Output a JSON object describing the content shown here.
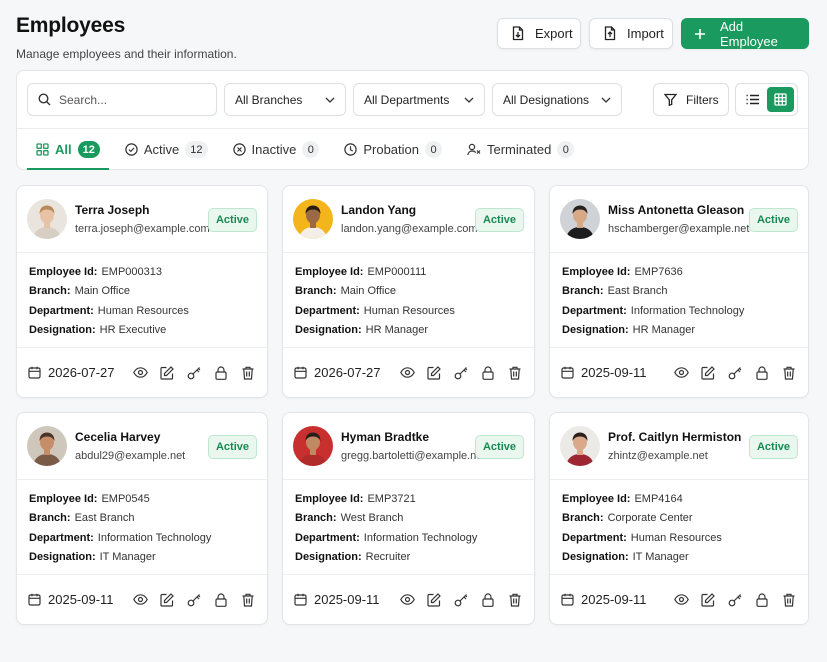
{
  "header": {
    "title": "Employees",
    "subtitle": "Manage employees and their information."
  },
  "actions": {
    "export_label": "Export",
    "import_label": "Import",
    "add_label": "Add Employee"
  },
  "filters": {
    "search_placeholder": "Search...",
    "branch": "All Branches",
    "department": "All Departments",
    "designation": "All Designations",
    "filters_label": "Filters"
  },
  "tabs": [
    {
      "label": "All",
      "count": "12"
    },
    {
      "label": "Active",
      "count": "12"
    },
    {
      "label": "Inactive",
      "count": "0"
    },
    {
      "label": "Probation",
      "count": "0"
    },
    {
      "label": "Terminated",
      "count": "0"
    }
  ],
  "labels": {
    "employee_id": "Employee Id:",
    "branch": "Branch:",
    "department": "Department:",
    "designation": "Designation:"
  },
  "colors": {
    "accent": "#1a9a5e",
    "badge_bg": "#e9f7ef",
    "badge_text": "#178a52"
  },
  "employees": [
    {
      "name": "Terra Joseph",
      "email": "terra.joseph@example.com",
      "status": "Active",
      "employee_id": "EMP000313",
      "branch": "Main Office",
      "department": "Human Resources",
      "designation": "HR Executive",
      "date": "2026-07-27"
    },
    {
      "name": "Landon Yang",
      "email": "landon.yang@example.com",
      "status": "Active",
      "employee_id": "EMP000111",
      "branch": "Main Office",
      "department": "Human Resources",
      "designation": "HR Manager",
      "date": "2026-07-27"
    },
    {
      "name": "Miss Antonetta Gleason",
      "email": "hschamberger@example.net",
      "status": "Active",
      "employee_id": "EMP7636",
      "branch": "East Branch",
      "department": "Information Technology",
      "designation": "HR Manager",
      "date": "2025-09-11"
    },
    {
      "name": "Cecelia Harvey",
      "email": "abdul29@example.net",
      "status": "Active",
      "employee_id": "EMP0545",
      "branch": "East Branch",
      "department": "Information Technology",
      "designation": "IT Manager",
      "date": "2025-09-11"
    },
    {
      "name": "Hyman Bradtke",
      "email": "gregg.bartoletti@example.net",
      "status": "Active",
      "employee_id": "EMP3721",
      "branch": "West Branch",
      "department": "Information Technology",
      "designation": "Recruiter",
      "date": "2025-09-11"
    },
    {
      "name": "Prof. Caitlyn Hermiston",
      "email": "zhintz@example.net",
      "status": "Active",
      "employee_id": "EMP4164",
      "branch": "Corporate Center",
      "department": "Human Resources",
      "designation": "IT Manager",
      "date": "2025-09-11"
    }
  ]
}
